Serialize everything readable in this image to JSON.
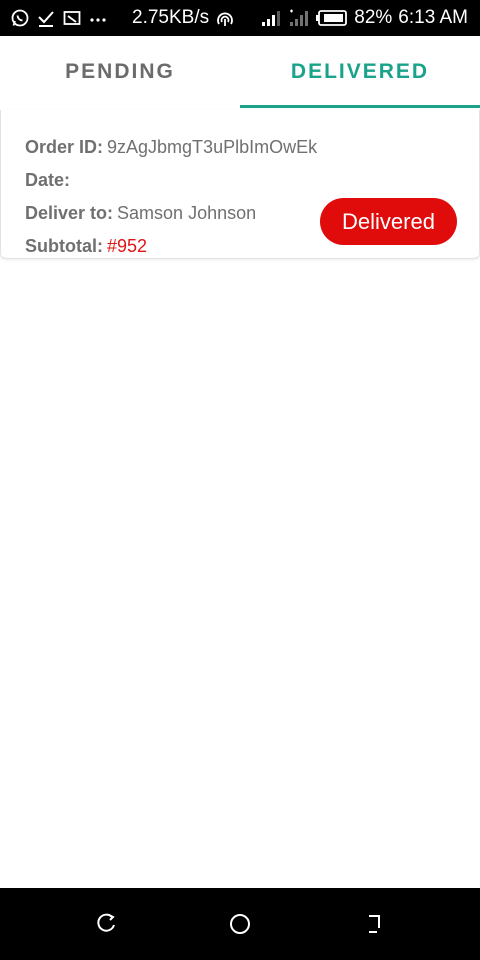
{
  "status_bar": {
    "speed": "2.75KB/s",
    "battery": "82%",
    "time": "6:13 AM",
    "icons": [
      "whatsapp-icon",
      "check-icon",
      "cast-icon",
      "more-dots-icon",
      "hotspot-icon",
      "signal-icon",
      "signal-weak-icon",
      "battery-icon"
    ]
  },
  "tabs": [
    {
      "label": "PENDING",
      "active": false
    },
    {
      "label": "DELIVERED",
      "active": true
    }
  ],
  "order": {
    "order_id_label": "Order ID:",
    "order_id_value": "9zAgJbmgT3uPlbImOwEk",
    "date_label": "Date:",
    "deliver_to_label": "Deliver to:",
    "deliver_to_value": "Samson Johnson",
    "subtotal_label": "Subtotal:",
    "subtotal_value": "#952",
    "status_label": "Delivered"
  },
  "colors": {
    "accent": "#1aa38a",
    "status_red": "#e00b0b",
    "subtotal_red": "#e01414"
  },
  "nav_bar": {
    "icons": [
      "recents-icon",
      "home-icon",
      "back-icon"
    ]
  }
}
